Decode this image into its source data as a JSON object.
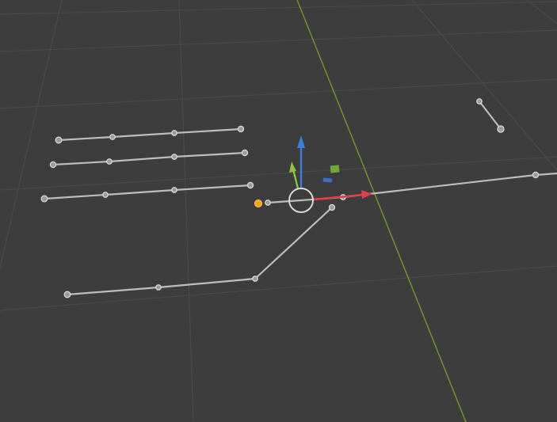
{
  "viewport": {
    "background": "#3d3d3d",
    "grid_color": "#4a4a4a",
    "axis_color": "#6f8f2a"
  },
  "colors": {
    "curve_line": "#bdbdbd",
    "point_fill": "#9a9a9a",
    "point_stroke": "#d4d4d4",
    "gizmo_x": "#e0404e",
    "gizmo_y": "#8bc53b",
    "gizmo_z": "#3a7fe0",
    "plane_xy": "#3a6fd0",
    "plane_xz": "#6fa83a",
    "gizmo_ring": "#d9d9d9",
    "origin": "#f5a30f"
  },
  "icons": {
    "origin": "origin-dot-icon",
    "gizmo_center": "gizmo-center-ring-icon",
    "gizmo_x": "x-axis-arrow-icon",
    "gizmo_y": "y-axis-arrow-icon",
    "gizmo_z": "z-axis-arrow-icon",
    "plane_xy": "xy-plane-handle-icon",
    "plane_xz": "xz-plane-handle-icon"
  }
}
